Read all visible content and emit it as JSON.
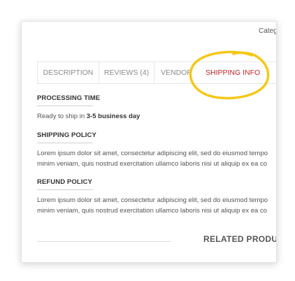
{
  "header": {
    "category_label": "Categ"
  },
  "tabs": [
    {
      "label": "DESCRIPTION"
    },
    {
      "label": "REVIEWS (4)"
    },
    {
      "label": "VENDOR"
    },
    {
      "label": "SHIPPING INFO"
    }
  ],
  "active_tab_color": "#c0262a",
  "highlight_color": "#f4c81a",
  "sections": {
    "processing": {
      "title": "PROCESSING TIME",
      "text_prefix": "Ready to ship in ",
      "text_bold": "3-5 business day"
    },
    "shipping": {
      "title": "SHIPPING POLICY",
      "line1": "Lorem ipsum dolor sit amet, consectetur adipiscing elit, sed do eiusmod tempo",
      "line2": "minim veniam, quis nostrud exercitation ullamco laboris nisi ut aliquip ex ea co"
    },
    "refund": {
      "title": "REFUND POLICY",
      "line1": "Lorem ipsum dolor sit amet, consectetur adipiscing elit, sed do eiusmod tempo",
      "line2": "minim veniam, quis nostrud exercitation ullamco laboris nisi ut aliquip ex ea co"
    }
  },
  "related": {
    "title": "RELATED PRODU"
  }
}
